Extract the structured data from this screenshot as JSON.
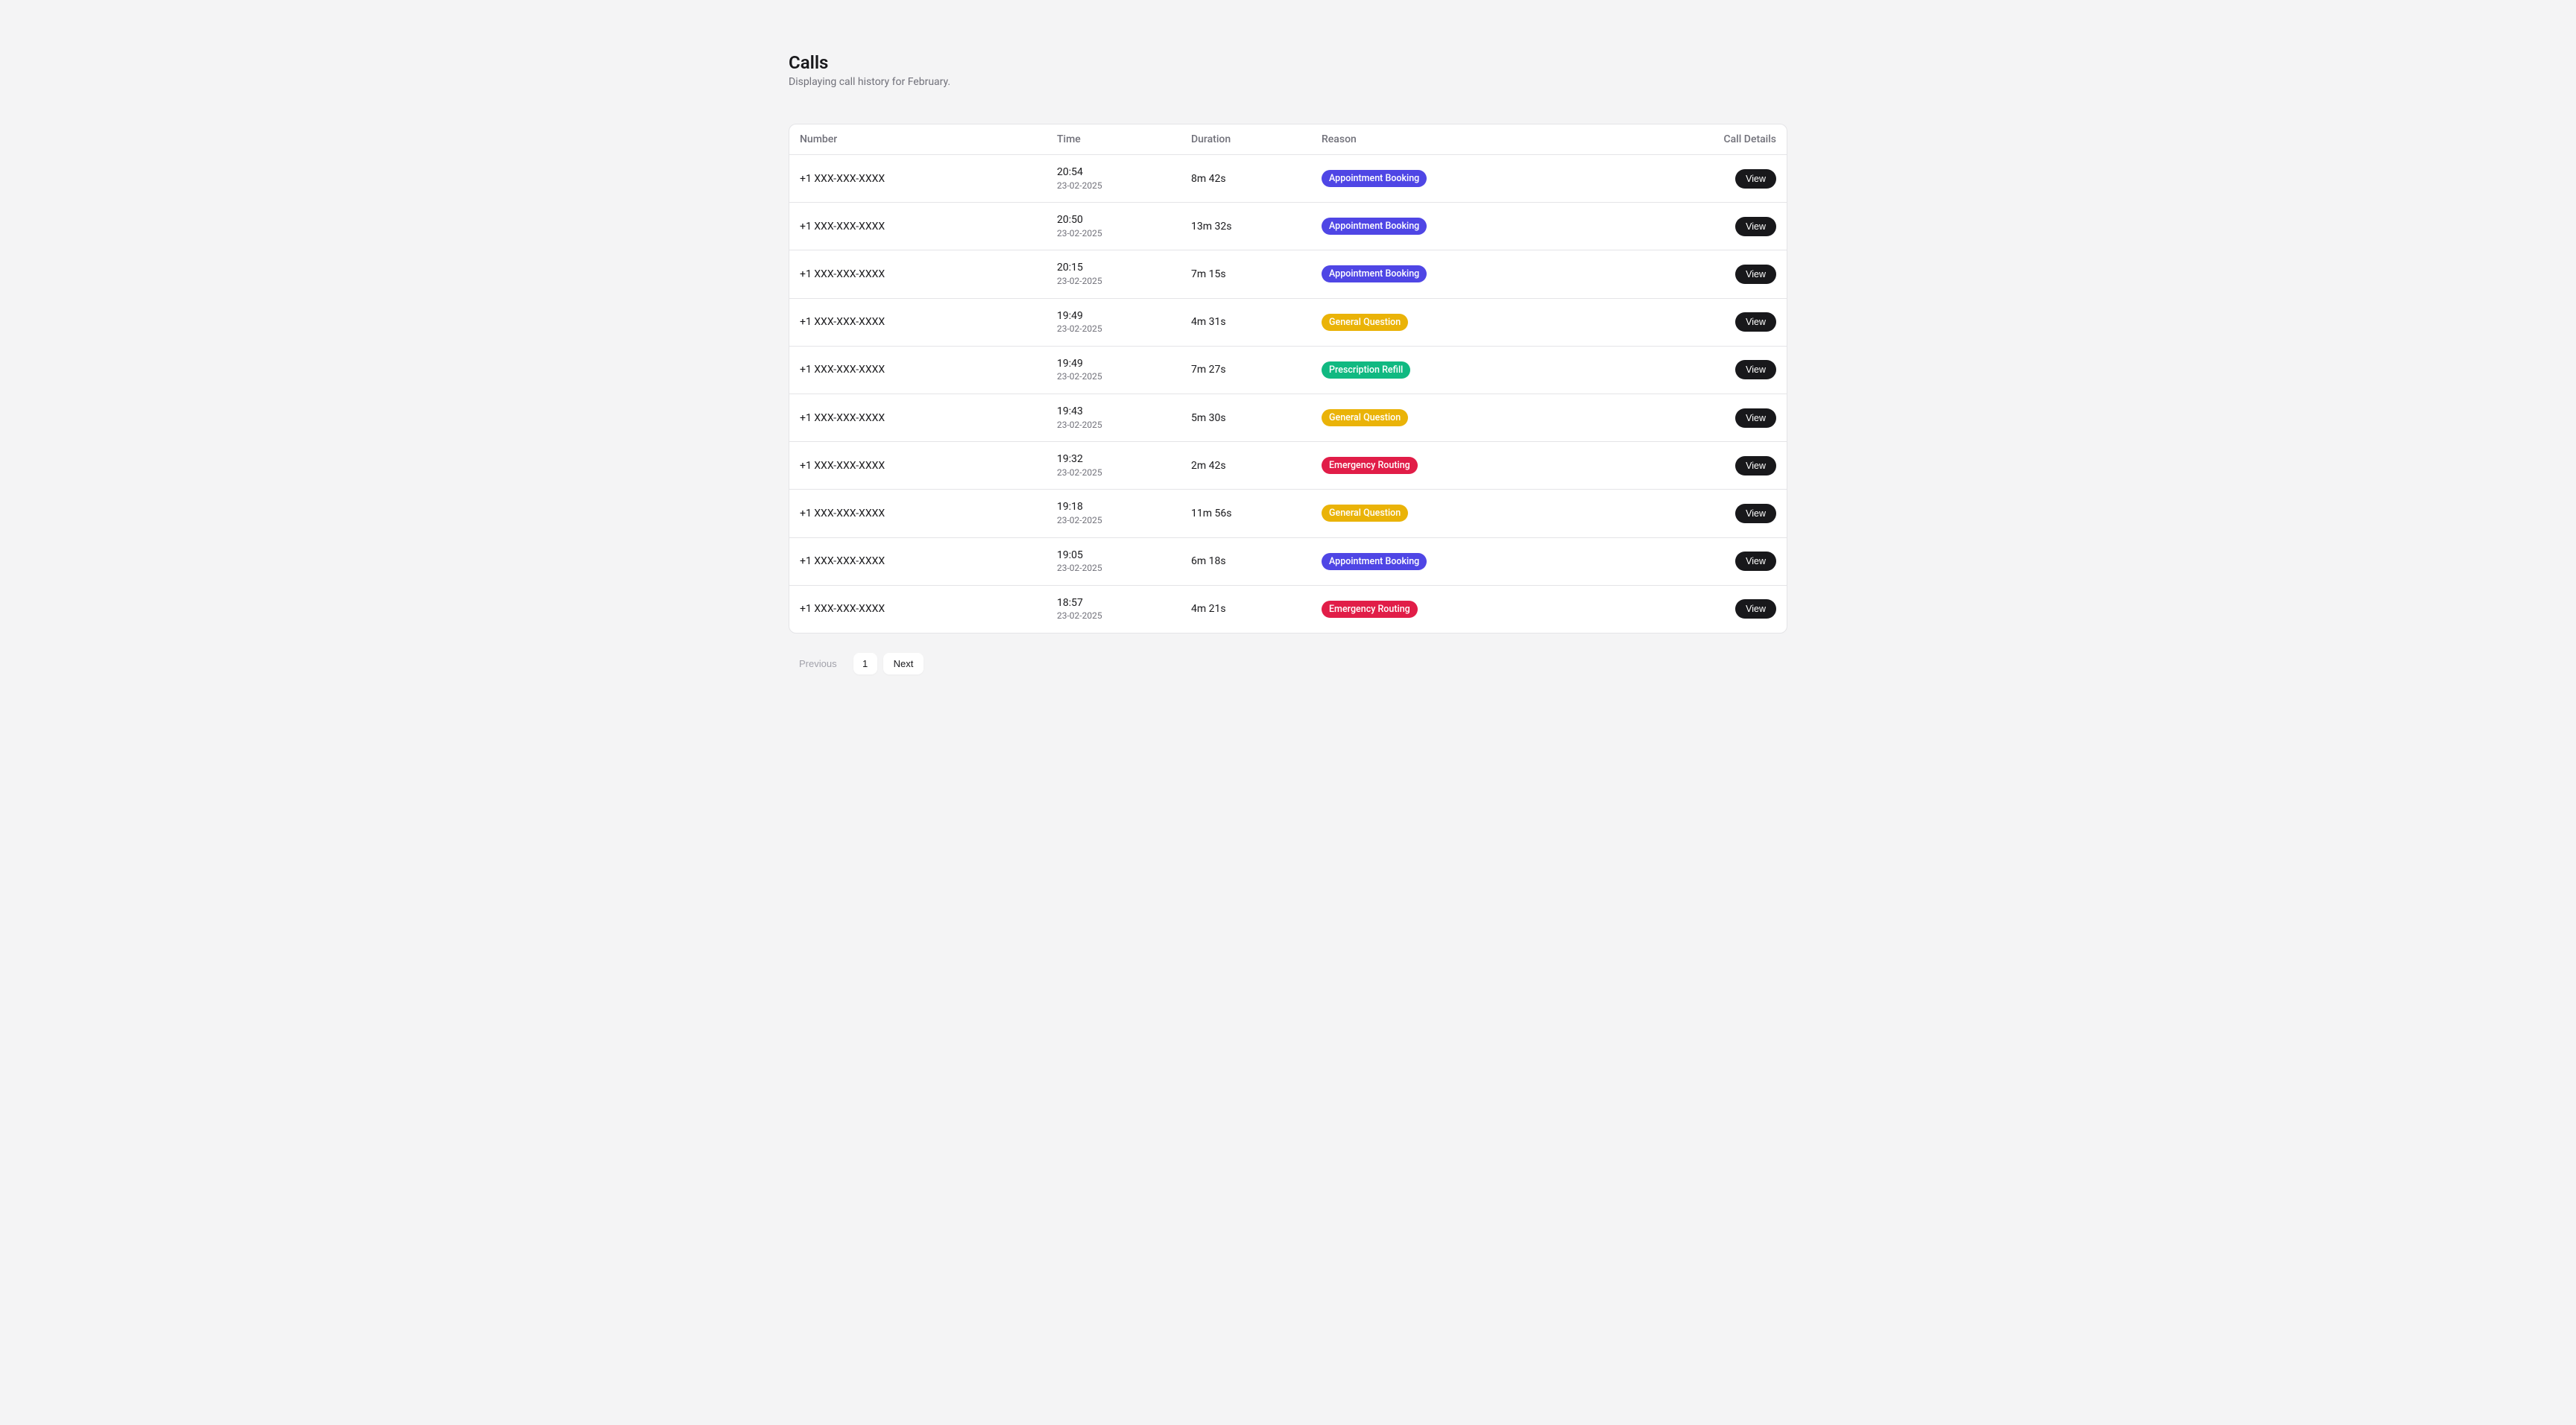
{
  "page": {
    "title": "Calls",
    "subtitle": "Displaying call history for February."
  },
  "table": {
    "headers": {
      "number": "Number",
      "time": "Time",
      "duration": "Duration",
      "reason": "Reason",
      "details": "Call Details"
    },
    "view_label": "View",
    "reason_colors": {
      "Appointment Booking": "#4f46e5",
      "General Question": "#eab308",
      "Prescription Refill": "#10b981",
      "Emergency Routing": "#e11d48"
    },
    "rows": [
      {
        "number": "+1 XXX-XXX-XXXX",
        "time": "20:54",
        "date": "23-02-2025",
        "duration": "8m 42s",
        "reason": "Appointment Booking"
      },
      {
        "number": "+1 XXX-XXX-XXXX",
        "time": "20:50",
        "date": "23-02-2025",
        "duration": "13m 32s",
        "reason": "Appointment Booking"
      },
      {
        "number": "+1 XXX-XXX-XXXX",
        "time": "20:15",
        "date": "23-02-2025",
        "duration": "7m 15s",
        "reason": "Appointment Booking"
      },
      {
        "number": "+1 XXX-XXX-XXXX",
        "time": "19:49",
        "date": "23-02-2025",
        "duration": "4m 31s",
        "reason": "General Question"
      },
      {
        "number": "+1 XXX-XXX-XXXX",
        "time": "19:49",
        "date": "23-02-2025",
        "duration": "7m 27s",
        "reason": "Prescription Refill"
      },
      {
        "number": "+1 XXX-XXX-XXXX",
        "time": "19:43",
        "date": "23-02-2025",
        "duration": "5m 30s",
        "reason": "General Question"
      },
      {
        "number": "+1 XXX-XXX-XXXX",
        "time": "19:32",
        "date": "23-02-2025",
        "duration": "2m 42s",
        "reason": "Emergency Routing"
      },
      {
        "number": "+1 XXX-XXX-XXXX",
        "time": "19:18",
        "date": "23-02-2025",
        "duration": "11m 56s",
        "reason": "General Question"
      },
      {
        "number": "+1 XXX-XXX-XXXX",
        "time": "19:05",
        "date": "23-02-2025",
        "duration": "6m 18s",
        "reason": "Appointment Booking"
      },
      {
        "number": "+1 XXX-XXX-XXXX",
        "time": "18:57",
        "date": "23-02-2025",
        "duration": "4m 21s",
        "reason": "Emergency Routing"
      }
    ]
  },
  "pagination": {
    "previous": "Previous",
    "next": "Next",
    "current": "1"
  }
}
